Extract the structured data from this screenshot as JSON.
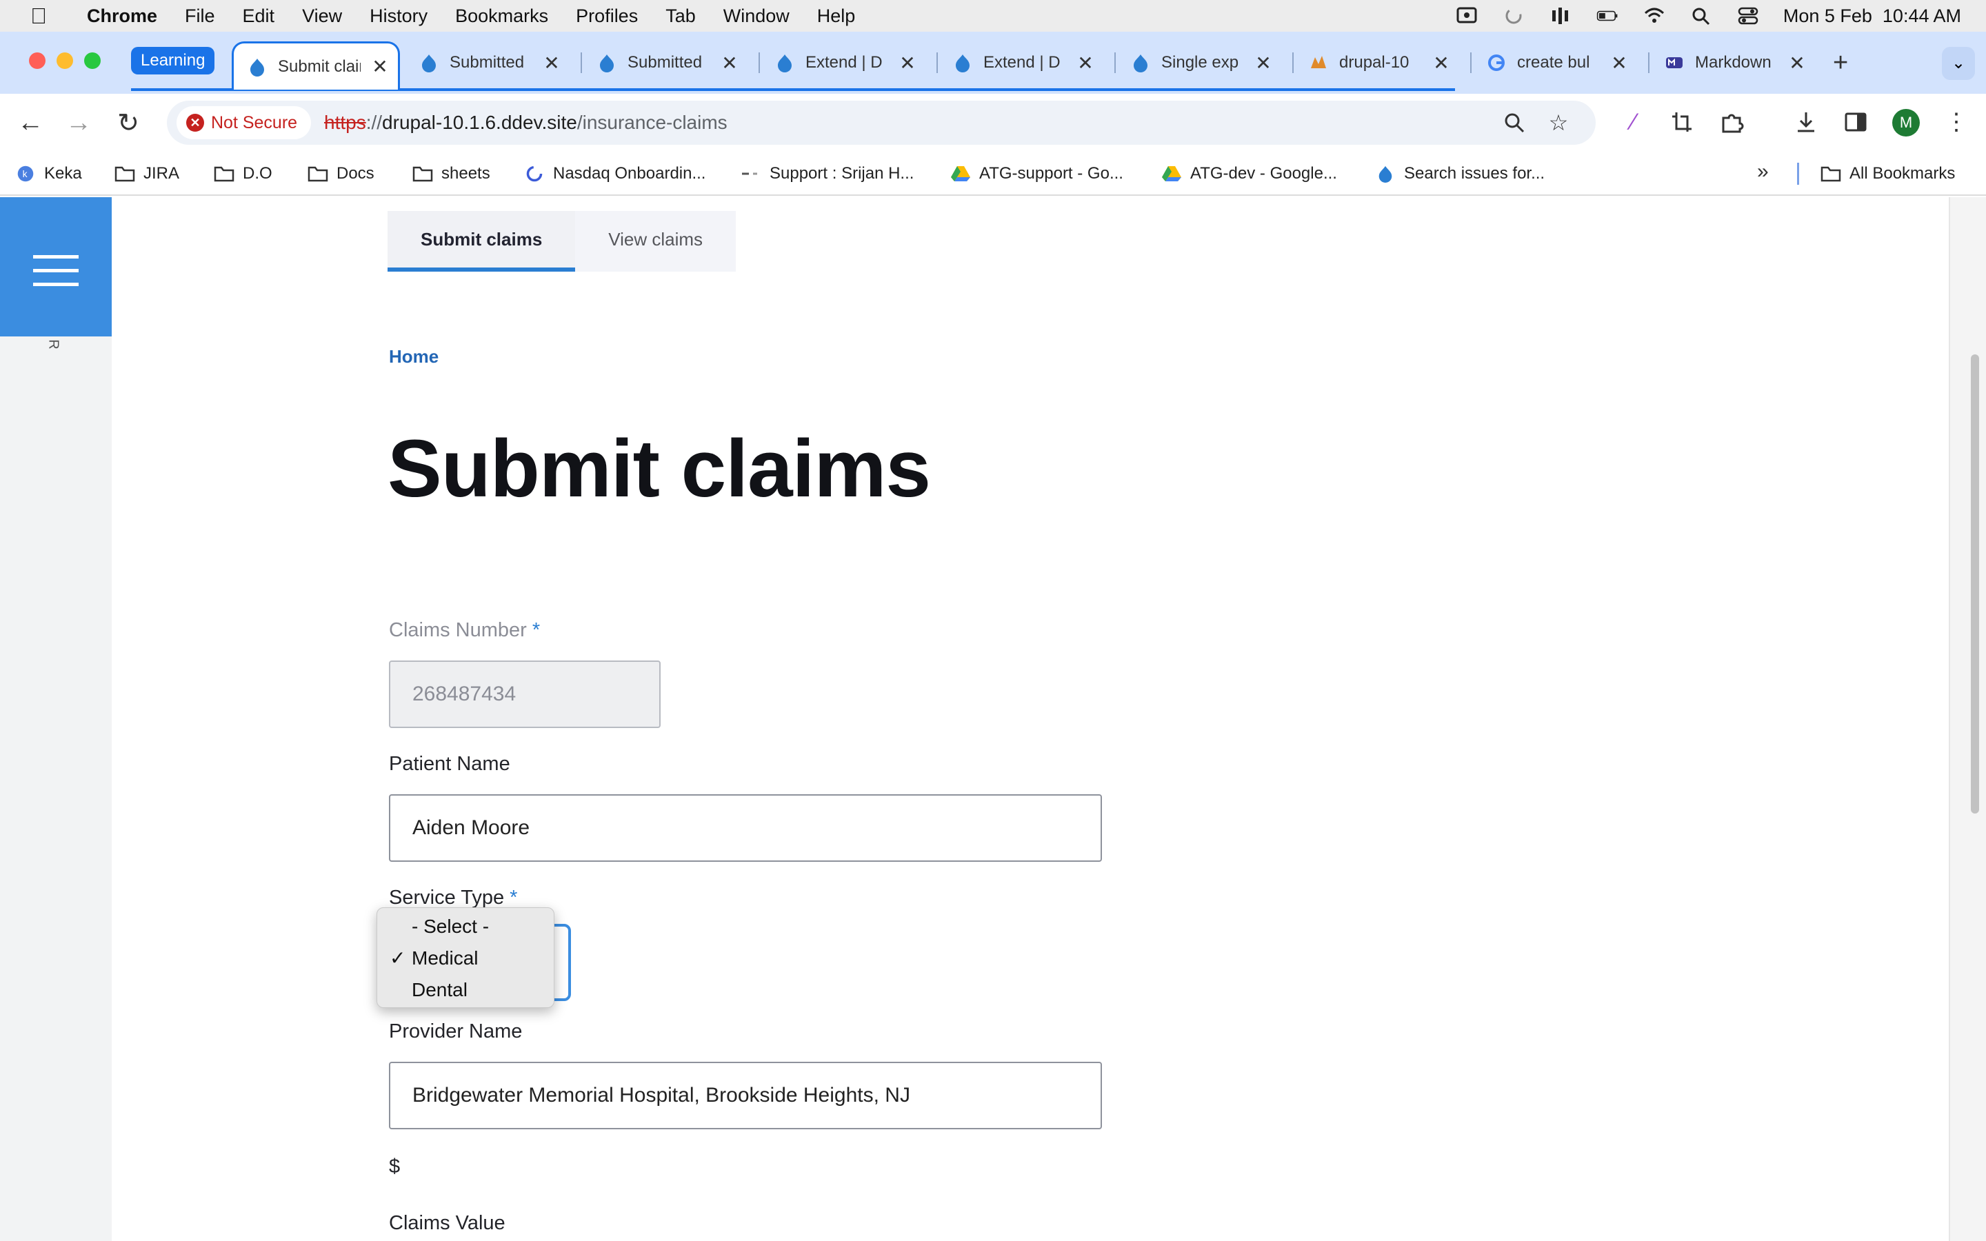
{
  "menubar": {
    "app": "Chrome",
    "items": [
      "File",
      "Edit",
      "View",
      "History",
      "Bookmarks",
      "Profiles",
      "Tab",
      "Window",
      "Help"
    ],
    "clock": "Mon 5 Feb  10:44 AM"
  },
  "tabs": {
    "group_label": "Learning",
    "items": [
      {
        "title": "Submit claims",
        "icon": "drupal-icon"
      },
      {
        "title": "Submitted",
        "icon": "drupal-icon"
      },
      {
        "title": "Submitted",
        "icon": "drupal-icon"
      },
      {
        "title": "Extend | D",
        "icon": "drupal-icon"
      },
      {
        "title": "Extend | D",
        "icon": "drupal-icon"
      },
      {
        "title": "Single exp",
        "icon": "drupal-icon"
      },
      {
        "title": "drupal-10",
        "icon": "phpmyadmin-icon"
      },
      {
        "title": "create bul",
        "icon": "google-icon"
      },
      {
        "title": "Markdown",
        "icon": "markdown-icon"
      }
    ]
  },
  "toolbar": {
    "security_label": "Not Secure",
    "url_scheme": "https",
    "url_sep": "://",
    "url_host": "drupal-10.1.6.ddev.site",
    "url_path": "/insurance-claims",
    "avatar_letter": "M"
  },
  "bookmarks": {
    "items": [
      "Keka",
      "JIRA",
      "D.O",
      "Docs",
      "sheets",
      "Nasdaq Onboardin...",
      "Support : Srijan H...",
      "ATG-support - Go...",
      "ATG-dev - Google...",
      "Search issues for..."
    ],
    "all_label": "All Bookmarks"
  },
  "page": {
    "local_tabs": [
      "Submit claims",
      "View claims"
    ],
    "breadcrumb": "Home",
    "title": "Submit claims",
    "fields": {
      "claims_number_label": "Claims Number",
      "claims_number_value": "268487434",
      "patient_name_label": "Patient Name",
      "patient_name_value": "Aiden Moore",
      "service_type_label": "Service Type",
      "service_type_options": [
        "- Select -",
        "Medical",
        "Dental"
      ],
      "service_type_selected": "Medical",
      "provider_name_label": "Provider Name",
      "provider_name_value": "Bridgewater Memorial Hospital, Brookside Heights, NJ",
      "currency_symbol": "$",
      "claims_value_label": "Claims Value"
    },
    "required_marker": "*"
  },
  "colors": {
    "accent": "#2a7ed2",
    "tabstrip": "#d3e3fd",
    "hamburger": "#3b8de0",
    "insecure": "#c5221f"
  }
}
